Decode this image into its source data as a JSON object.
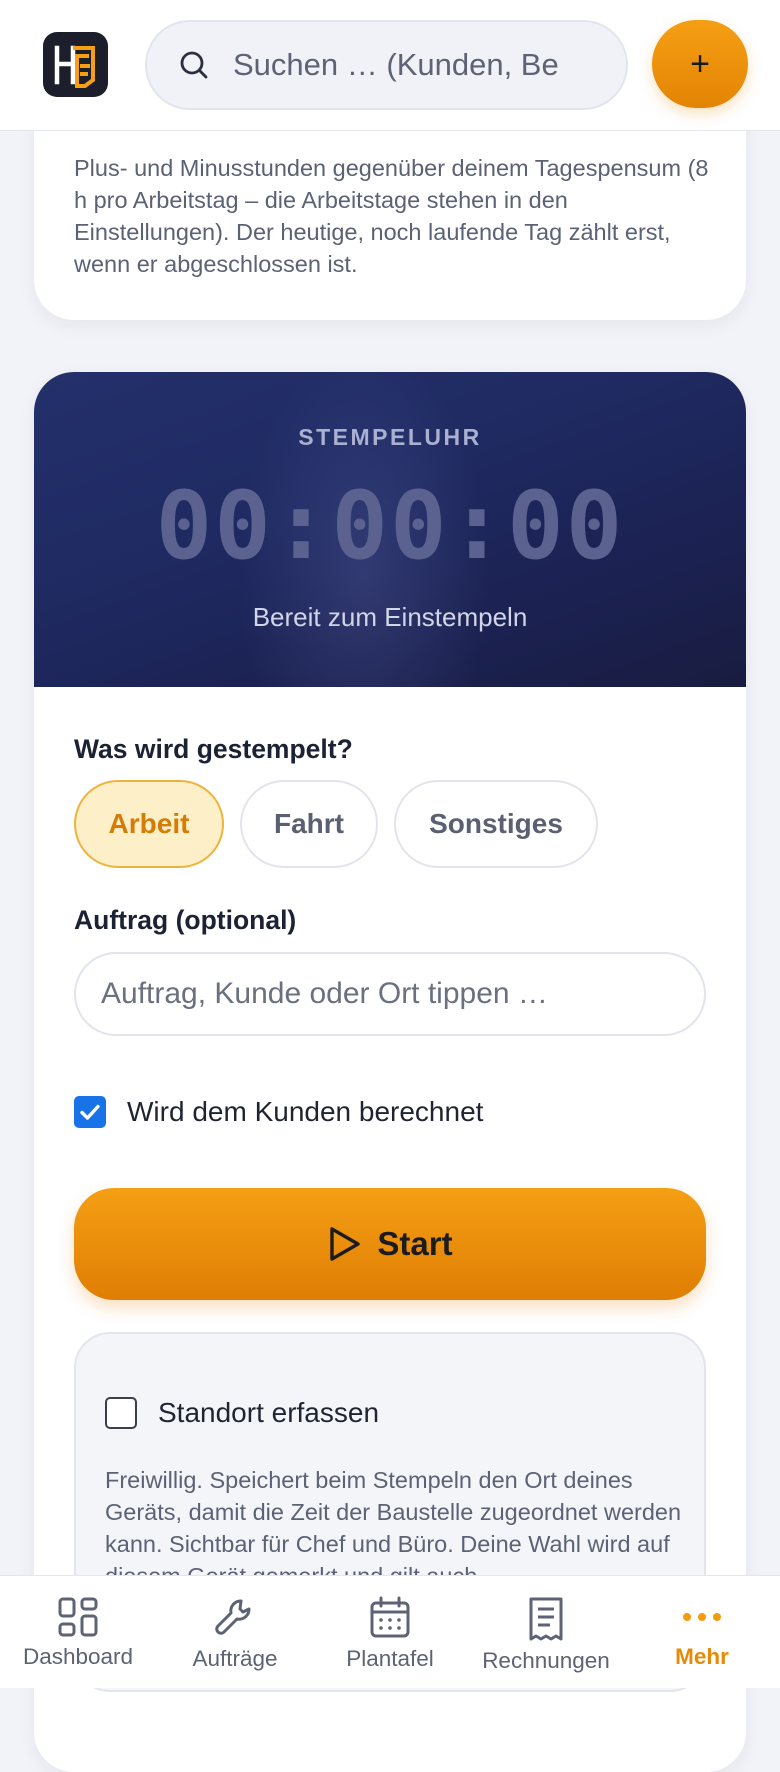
{
  "header": {
    "search_placeholder": "Suchen … (Kunden, Be",
    "add_label": "+"
  },
  "info": {
    "text": "Plus- und Minusstunden gegenüber deinem Tagespensum (8 h pro Arbeitstag – die Arbeitstage stehen in den Einstellungen). Der heutige, noch laufende Tag zählt erst, wenn er abgeschlossen ist."
  },
  "clock": {
    "label": "STEMPELUHR",
    "time": "00:00:00",
    "status": "Bereit zum Einstempeln"
  },
  "form": {
    "type_label": "Was wird gestempelt?",
    "types": [
      "Arbeit",
      "Fahrt",
      "Sonstiges"
    ],
    "selected_type": "Arbeit",
    "job_label": "Auftrag (optional)",
    "job_placeholder": "Auftrag, Kunde oder Ort tippen …",
    "billable_label": "Wird dem Kunden berechnet",
    "billable_checked": true,
    "start_label": "Start"
  },
  "location": {
    "label": "Standort erfassen",
    "checked": false,
    "text": "Freiwillig. Speichert beim Stempeln den Ort deines Geräts, damit die Zeit der Baustelle zugeordnet werden kann. Sichtbar für Chef und Büro. Deine Wahl wird auf diesem Gerät gemerkt und gilt auch"
  },
  "nav": {
    "items": [
      {
        "label": "Dashboard",
        "icon": "dashboard-icon"
      },
      {
        "label": "Aufträge",
        "icon": "wrench-icon"
      },
      {
        "label": "Plantafel",
        "icon": "calendar-icon"
      },
      {
        "label": "Rechnungen",
        "icon": "receipt-icon"
      },
      {
        "label": "Mehr",
        "icon": "more-icon"
      }
    ],
    "active": "Mehr"
  },
  "colors": {
    "accent": "#f39c12",
    "accent_active_text": "#e68a07",
    "clock_bg": "#1f2a62",
    "checkbox_blue": "#1873e8"
  }
}
